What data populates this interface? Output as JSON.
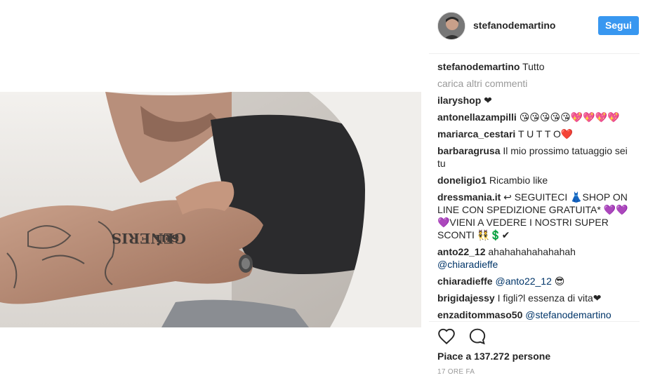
{
  "post": {
    "author": "stefanodemartino",
    "follow_label": "Segui",
    "caption_user": "stefanodemartino",
    "caption_text": "Tutto",
    "load_more": "carica altri commenti"
  },
  "comments": [
    {
      "user": "ilaryshop",
      "text": "❤"
    },
    {
      "user": "antonellazampilli",
      "text": "😘😘😘😘😘💖💖💖💖"
    },
    {
      "user": "mariarca_cestari",
      "text": "T U T T O❤️"
    },
    {
      "user": "barbaragrusa",
      "text": "Il mio prossimo tatuaggio sei tu"
    },
    {
      "user": "doneligio1",
      "text": "Ricambio like"
    },
    {
      "user": "dressmania.it",
      "text": "↩ SEGUITECI 👗SHOP ON LINE CON SPEDIZIONE GRATUITA* 💜💜💜VIENI A VEDERE I NOSTRI SUPER SCONTI 👯💲✔"
    },
    {
      "user": "anto22_12",
      "text": "ahahahahahahahah",
      "mention": "@chiaradieffe"
    },
    {
      "user": "chiaradieffe",
      "mention": "@anto22_12",
      "text": "😎"
    },
    {
      "user": "brigidajessy",
      "text": "I figli?l essenza di vita❤"
    },
    {
      "user": "enzaditommaso50",
      "mention": "@stefanodemartino"
    }
  ],
  "footer": {
    "likes": "Piace a 137.272 persone",
    "time": "17 ORE FA"
  },
  "icons": {
    "like": "heart-icon",
    "comment": "comment-bubble-icon"
  }
}
